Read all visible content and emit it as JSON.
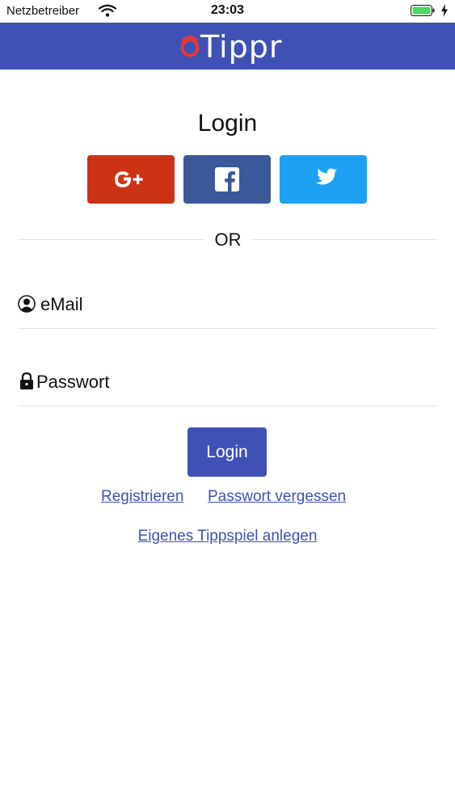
{
  "status_bar": {
    "carrier": "Netzbetreiber",
    "time": "23:03"
  },
  "nav": {
    "app_name": "Tippr",
    "logo_color": "#e53935",
    "bar_color": "#3f51b5"
  },
  "login": {
    "title": "Login",
    "social_buttons": [
      {
        "name": "google",
        "icon": "google-plus-icon",
        "color": "#cc3314"
      },
      {
        "name": "facebook",
        "icon": "facebook-icon",
        "color": "#3b5998"
      },
      {
        "name": "twitter",
        "icon": "twitter-icon",
        "color": "#1da1f2"
      }
    ],
    "divider_text": "OR",
    "email_placeholder": "eMail",
    "password_placeholder": "Passwort",
    "submit_label": "Login",
    "register_link": "Registrieren",
    "forgot_link": "Passwort vergessen",
    "own_game_link": "Eigenes Tippspiel anlegen"
  }
}
